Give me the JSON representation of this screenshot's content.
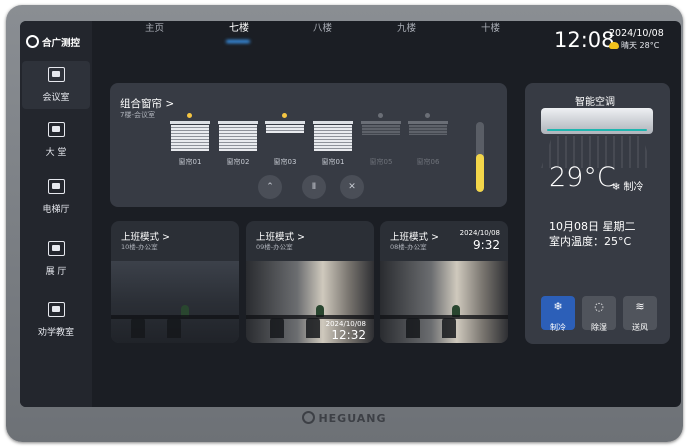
{
  "brand": "合广测控",
  "device_brand": "HEGUANG",
  "sidebar": {
    "items": [
      {
        "label": "会议室",
        "icon": "meeting-room-icon",
        "active": true
      },
      {
        "label": "大 堂",
        "icon": "lobby-icon"
      },
      {
        "label": "电梯厅",
        "icon": "elevator-hall-icon"
      },
      {
        "label": "展 厅",
        "icon": "exhibition-hall-icon"
      },
      {
        "label": "劝学教室",
        "icon": "classroom-icon"
      }
    ]
  },
  "header": {
    "tabs": [
      {
        "label": "主页"
      },
      {
        "label": "七楼",
        "active": true
      },
      {
        "label": "八楼"
      },
      {
        "label": "九楼"
      },
      {
        "label": "十楼"
      }
    ],
    "time": "12:08",
    "date": "2024/10/08",
    "weather": "晴天 28°C",
    "weather_icon": "partly-sunny-icon"
  },
  "curtain_panel": {
    "title": "组合窗帘 >",
    "subtitle": "7楼-会议室",
    "curtains": [
      {
        "name": "窗帘01",
        "on": true
      },
      {
        "name": "窗帘02",
        "on": false
      },
      {
        "name": "窗帘03",
        "on": true
      },
      {
        "name": "窗帘01",
        "on": false
      },
      {
        "name": "窗帘05",
        "on": false
      },
      {
        "name": "窗帘06",
        "on": false
      }
    ],
    "controls": [
      "open-icon",
      "pause-icon",
      "close-icon"
    ],
    "level_percent": 55
  },
  "modes": [
    {
      "title": "上班模式 >",
      "subtitle": "10楼-办公室",
      "date": "",
      "time": ""
    },
    {
      "title": "上班模式 >",
      "subtitle": "09楼-办公室",
      "date": "2024/10/08",
      "time": "12:32"
    },
    {
      "title": "上班模式 >",
      "subtitle": "08楼-办公室",
      "date": "2024/10/08",
      "time": "9:32"
    }
  ],
  "aircon": {
    "title": "智能空调",
    "temperature": "29°C",
    "mode_text": "❄ 制冷",
    "date_line": "10月08日  星期二",
    "indoor_line": "室内温度：25°C",
    "buttons": [
      {
        "label": "制冷",
        "icon": "snowflake-icon",
        "glyph": "❄",
        "active": true
      },
      {
        "label": "除湿",
        "icon": "water-drop-icon",
        "glyph": "💧"
      },
      {
        "label": "送风",
        "icon": "wind-icon",
        "glyph": "≋"
      }
    ]
  },
  "colors": {
    "accent": "#3da0ff",
    "active_dot": "#f5c542",
    "slider_fill": "#f3d64a",
    "active_button": "#2c5fb8"
  }
}
